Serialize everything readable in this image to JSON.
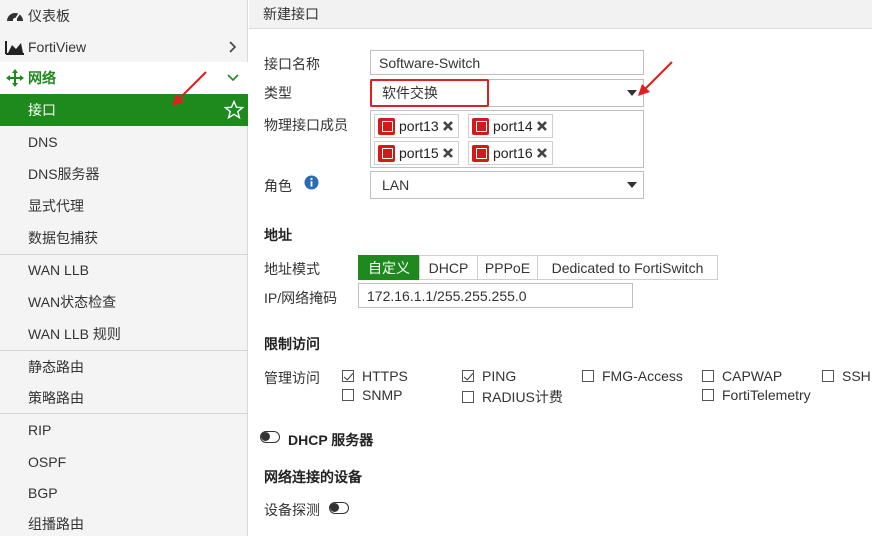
{
  "sidebar": {
    "dashboard": "仪表板",
    "fortiview": "FortiView",
    "network": "网络",
    "items": [
      "接口",
      "DNS",
      "DNS服务器",
      "显式代理",
      "数据包捕获",
      "WAN LLB",
      "WAN状态检查",
      "WAN LLB 规则",
      "静态路由",
      "策略路由",
      "RIP",
      "OSPF",
      "BGP",
      "组播路由"
    ]
  },
  "main": {
    "title": "新建接口",
    "labels": {
      "name": "接口名称",
      "type": "类型",
      "members": "物理接口成员",
      "role": "角色",
      "address_section": "地址",
      "address_mode": "地址模式",
      "ip_mask": "IP/网络掩码",
      "restrict_section": "限制访问",
      "admin_access": "管理访问",
      "dhcp_server": "DHCP 服务器",
      "connected_devices": "网络连接的设备",
      "device_detection": "设备探测"
    },
    "name_value": "Software-Switch",
    "type_value": "软件交换",
    "members": [
      "port13",
      "port14",
      "port15",
      "port16"
    ],
    "role_value": "LAN",
    "address_modes": [
      "自定义",
      "DHCP",
      "PPPoE",
      "Dedicated to FortiSwitch"
    ],
    "ip_value": "172.16.1.1/255.255.255.0",
    "access": [
      {
        "label": "HTTPS",
        "checked": true
      },
      {
        "label": "PING",
        "checked": true
      },
      {
        "label": "FMG-Access",
        "checked": false
      },
      {
        "label": "CAPWAP",
        "checked": false
      },
      {
        "label": "SSH",
        "checked": false
      },
      {
        "label": "SNMP",
        "checked": false
      },
      {
        "label": "RADIUS计费",
        "checked": false
      },
      {
        "label": "FortiTelemetry",
        "checked": false
      }
    ]
  },
  "colors": {
    "accent": "#1e8a1e",
    "highlight": "#e02020",
    "port_icon": "#d11b1b"
  }
}
